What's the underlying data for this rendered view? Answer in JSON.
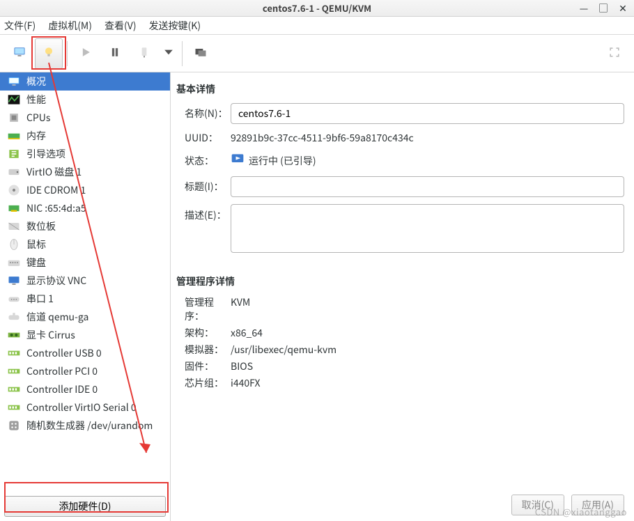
{
  "window": {
    "title": "centos7.6-1 - QEMU/KVM"
  },
  "menubar": {
    "file": "文件(F)",
    "vm": "虚拟机(M)",
    "view": "查看(V)",
    "send": "发送按键(K)"
  },
  "sidebar": {
    "items": [
      {
        "label": "概况",
        "icon": "monitor-icon",
        "selected": true
      },
      {
        "label": "性能",
        "icon": "chart-icon",
        "selected": false
      },
      {
        "label": "CPUs",
        "icon": "cpu-icon",
        "selected": false
      },
      {
        "label": "内存",
        "icon": "ram-icon",
        "selected": false
      },
      {
        "label": "引导选项",
        "icon": "boot-icon",
        "selected": false
      },
      {
        "label": "VirtIO 磁盘 1",
        "icon": "disk-icon",
        "selected": false
      },
      {
        "label": "IDE CDROM 1",
        "icon": "cdrom-icon",
        "selected": false
      },
      {
        "label": "NIC :65:4d:a5",
        "icon": "nic-icon",
        "selected": false
      },
      {
        "label": "数位板",
        "icon": "tablet-icon",
        "selected": false
      },
      {
        "label": "鼠标",
        "icon": "mouse-icon",
        "selected": false
      },
      {
        "label": "键盘",
        "icon": "keyboard-icon",
        "selected": false
      },
      {
        "label": "显示协议 VNC",
        "icon": "display-icon",
        "selected": false
      },
      {
        "label": "串口 1",
        "icon": "serial-icon",
        "selected": false
      },
      {
        "label": "信道 qemu-ga",
        "icon": "channel-icon",
        "selected": false
      },
      {
        "label": "显卡 Cirrus",
        "icon": "gpu-icon",
        "selected": false
      },
      {
        "label": "Controller USB 0",
        "icon": "controller-icon",
        "selected": false
      },
      {
        "label": "Controller PCI 0",
        "icon": "controller-icon",
        "selected": false
      },
      {
        "label": "Controller IDE 0",
        "icon": "controller-icon",
        "selected": false
      },
      {
        "label": "Controller VirtIO Serial 0",
        "icon": "controller-icon",
        "selected": false
      },
      {
        "label": "随机数生成器 /dev/urandom",
        "icon": "rng-icon",
        "selected": false
      }
    ],
    "add_hw_label": "添加硬件(D)"
  },
  "basic": {
    "section_title": "基本详情",
    "name_label": "名称(N)：",
    "name_value": "centos7.6-1",
    "uuid_label": "UUID：",
    "uuid_value": "92891b9c-37cc-4511-9bf6-59a8170c434c",
    "state_label": "状态：",
    "state_value": "运行中 (已引导)",
    "title_label": "标题(I)：",
    "title_value": "",
    "desc_label": "描述(E)：",
    "desc_value": ""
  },
  "hypervisor": {
    "section_title": "管理程序详情",
    "mgr_label": "管理程序：",
    "mgr_value": "KVM",
    "arch_label": "架构：",
    "arch_value": "x86_64",
    "emu_label": "模拟器：",
    "emu_value": "/usr/libexec/qemu-kvm",
    "fw_label": "固件：",
    "fw_value": "BIOS",
    "chip_label": "芯片组：",
    "chip_value": "i440FX"
  },
  "buttons": {
    "cancel": "取消(C)",
    "apply": "应用(A)"
  },
  "watermark": "CSDN @xiaotanggao"
}
